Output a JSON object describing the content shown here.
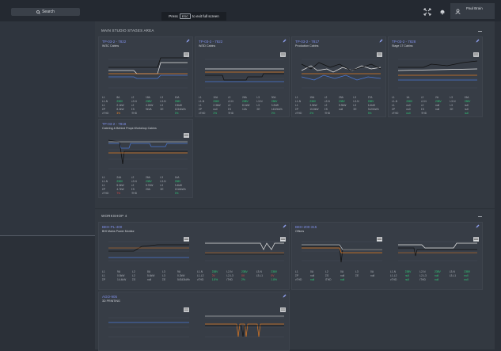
{
  "topbar": {
    "search_label": "Search",
    "fullscreen_pre": "Press",
    "fullscreen_key": "ESC",
    "fullscreen_post": "to exit full screen",
    "user_name": "Paul Brain"
  },
  "colors": {
    "background": "#2b3038",
    "panel": "#373d46",
    "title_link": "#7f8fe8",
    "series_blue": "#4a78d6",
    "series_orange": "#e07a22",
    "series_white": "#e8e8e8",
    "series_black": "#111111",
    "good": "#2fd07a",
    "warn": "#f08b2c",
    "bad": "#e04848"
  },
  "icons": [
    "search-icon",
    "expand-icon",
    "notification-icon",
    "user-icon",
    "edit-icon",
    "table-icon",
    "collapse-icon"
  ],
  "sections": {
    "main": {
      "title": "MAIN STUDIO STAGES AREA"
    },
    "workshop": {
      "title": "WORKSHOP 4"
    }
  },
  "panels": {
    "p1": {
      "title": "TP-03-2 - 7822",
      "subtitle": "W/3C Cabins"
    },
    "p2": {
      "title": "TP-03-2 - 7822",
      "subtitle": "W/3D Cabins"
    },
    "p3": {
      "title": "TP-03-2 - 7817",
      "subtitle": "Production Cabins"
    },
    "p4": {
      "title": "TP-03-2 - 7828",
      "subtitle": "Stage 17 Cabins"
    },
    "p5": {
      "title": "TP-03-2 - 7818",
      "subtitle": "Catering & Behind Props Workshop Cabins"
    },
    "p6": {
      "title": "BEH-PL-400",
      "subtitle": "BHI Mains Power Monitor"
    },
    "p7": {
      "title": "BEH-200-315",
      "subtitle": "Offices"
    },
    "p8": {
      "title": "AGO-905",
      "subtitle": "3D PRINTING"
    }
  }
}
